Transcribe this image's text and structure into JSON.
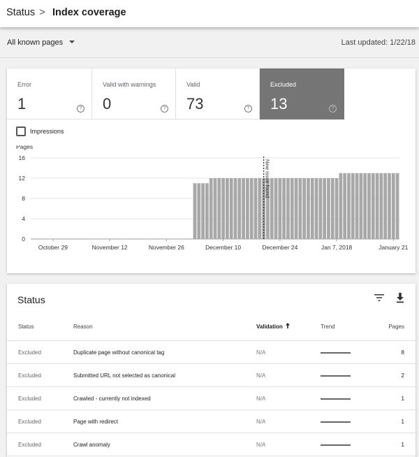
{
  "breadcrumb": {
    "root": "Status",
    "separator": ">",
    "current": "Index coverage"
  },
  "filter": {
    "selected": "All known pages",
    "last_updated": "Last updated: 1/22/18"
  },
  "tiles": [
    {
      "label": "Error",
      "value": "1",
      "help": "?",
      "selected": false
    },
    {
      "label": "Valid with warnings",
      "value": "0",
      "help": "?",
      "selected": false
    },
    {
      "label": "Valid",
      "value": "73",
      "help": "?",
      "selected": false
    },
    {
      "label": "Excluded",
      "value": "13",
      "help": "?",
      "selected": true
    }
  ],
  "impressions": {
    "label": "Impressions",
    "checked": false
  },
  "chart_data": {
    "type": "bar",
    "ylabel": "Pages",
    "ylim": [
      0,
      16
    ],
    "yticks": [
      0,
      4,
      8,
      12,
      16
    ],
    "x_start": "2017-10-24",
    "x_end": "2018-01-22",
    "xticks": [
      {
        "date": "2017-10-29",
        "label": "October 29"
      },
      {
        "date": "2017-11-12",
        "label": "November 12"
      },
      {
        "date": "2017-11-26",
        "label": "November 26"
      },
      {
        "date": "2017-12-10",
        "label": "December 10"
      },
      {
        "date": "2017-12-24",
        "label": "December 24"
      },
      {
        "date": "2018-01-07",
        "label": "Jan 7, 2018"
      },
      {
        "date": "2018-01-21",
        "label": "January 21"
      }
    ],
    "series": [
      {
        "name": "Excluded",
        "color": "#a8a8a8",
        "points": [
          [
            "2017-12-03",
            11
          ],
          [
            "2017-12-04",
            11
          ],
          [
            "2017-12-05",
            11
          ],
          [
            "2017-12-06",
            11
          ],
          [
            "2017-12-07",
            12
          ],
          [
            "2017-12-08",
            12
          ],
          [
            "2017-12-09",
            12
          ],
          [
            "2017-12-10",
            12
          ],
          [
            "2017-12-11",
            12
          ],
          [
            "2017-12-12",
            12
          ],
          [
            "2017-12-13",
            12
          ],
          [
            "2017-12-14",
            12
          ],
          [
            "2017-12-15",
            12
          ],
          [
            "2017-12-16",
            12
          ],
          [
            "2017-12-17",
            12
          ],
          [
            "2017-12-18",
            12
          ],
          [
            "2017-12-19",
            12
          ],
          [
            "2017-12-20",
            12
          ],
          [
            "2017-12-21",
            12
          ],
          [
            "2017-12-22",
            12
          ],
          [
            "2017-12-23",
            12
          ],
          [
            "2017-12-24",
            12
          ],
          [
            "2017-12-25",
            12
          ],
          [
            "2017-12-26",
            12
          ],
          [
            "2017-12-27",
            12
          ],
          [
            "2017-12-28",
            12
          ],
          [
            "2017-12-29",
            12
          ],
          [
            "2017-12-30",
            12
          ],
          [
            "2017-12-31",
            12
          ],
          [
            "2018-01-01",
            12
          ],
          [
            "2018-01-02",
            12
          ],
          [
            "2018-01-03",
            12
          ],
          [
            "2018-01-04",
            12
          ],
          [
            "2018-01-05",
            12
          ],
          [
            "2018-01-06",
            12
          ],
          [
            "2018-01-07",
            12
          ],
          [
            "2018-01-08",
            13
          ],
          [
            "2018-01-09",
            13
          ],
          [
            "2018-01-10",
            13
          ],
          [
            "2018-01-11",
            13
          ],
          [
            "2018-01-12",
            13
          ],
          [
            "2018-01-13",
            13
          ],
          [
            "2018-01-14",
            13
          ],
          [
            "2018-01-15",
            13
          ],
          [
            "2018-01-16",
            13
          ],
          [
            "2018-01-17",
            13
          ],
          [
            "2018-01-18",
            13
          ],
          [
            "2018-01-19",
            13
          ],
          [
            "2018-01-20",
            13
          ],
          [
            "2018-01-21",
            13
          ],
          [
            "2018-01-22",
            13
          ]
        ]
      }
    ],
    "annotations": [
      {
        "date": "2017-12-20",
        "label": "New issue found"
      }
    ],
    "grid": true
  },
  "status_table": {
    "title": "Status",
    "columns": {
      "status": "Status",
      "reason": "Reason",
      "validation": "Validation",
      "trend": "Trend",
      "pages": "Pages"
    },
    "sort_icon": "arrow-up-icon",
    "rows": [
      {
        "status": "Excluded",
        "reason": "Duplicate page without canonical tag",
        "validation": "N/A",
        "pages": "8"
      },
      {
        "status": "Excluded",
        "reason": "Submitted URL not selected as canonical",
        "validation": "N/A",
        "pages": "2"
      },
      {
        "status": "Excluded",
        "reason": "Crawled - currently not indexed",
        "validation": "N/A",
        "pages": "1"
      },
      {
        "status": "Excluded",
        "reason": "Page with redirect",
        "validation": "N/A",
        "pages": "1"
      },
      {
        "status": "Excluded",
        "reason": "Crawl anomaly",
        "validation": "N/A",
        "pages": "1"
      }
    ]
  }
}
